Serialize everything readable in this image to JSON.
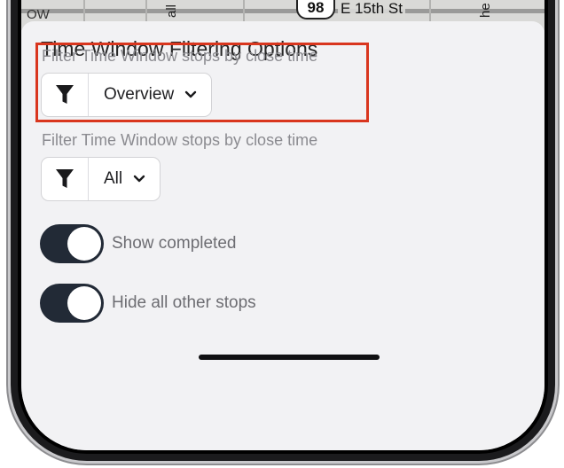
{
  "map": {
    "route_number": "98",
    "street_name": "E 15th St",
    "frag_left": "OW",
    "frag_vert_1": "all",
    "frag_vert_2": "he"
  },
  "sheet": {
    "title": "Time Window Filtering Options"
  },
  "filters": [
    {
      "label": "Filter Time Window stops by close time",
      "value": "Overview",
      "icon": "filter-funnel-icon",
      "highlighted": true
    },
    {
      "label": "Filter Time Window stops by close time",
      "value": "All",
      "icon": "filter-funnel-icon",
      "highlighted": false
    }
  ],
  "toggles": [
    {
      "label": "Show completed",
      "on": true
    },
    {
      "label": "Hide all other stops",
      "on": true
    }
  ],
  "colors": {
    "highlight": "#d9361e",
    "toggle_on": "#222a36",
    "label_muted": "#8b8b90"
  }
}
